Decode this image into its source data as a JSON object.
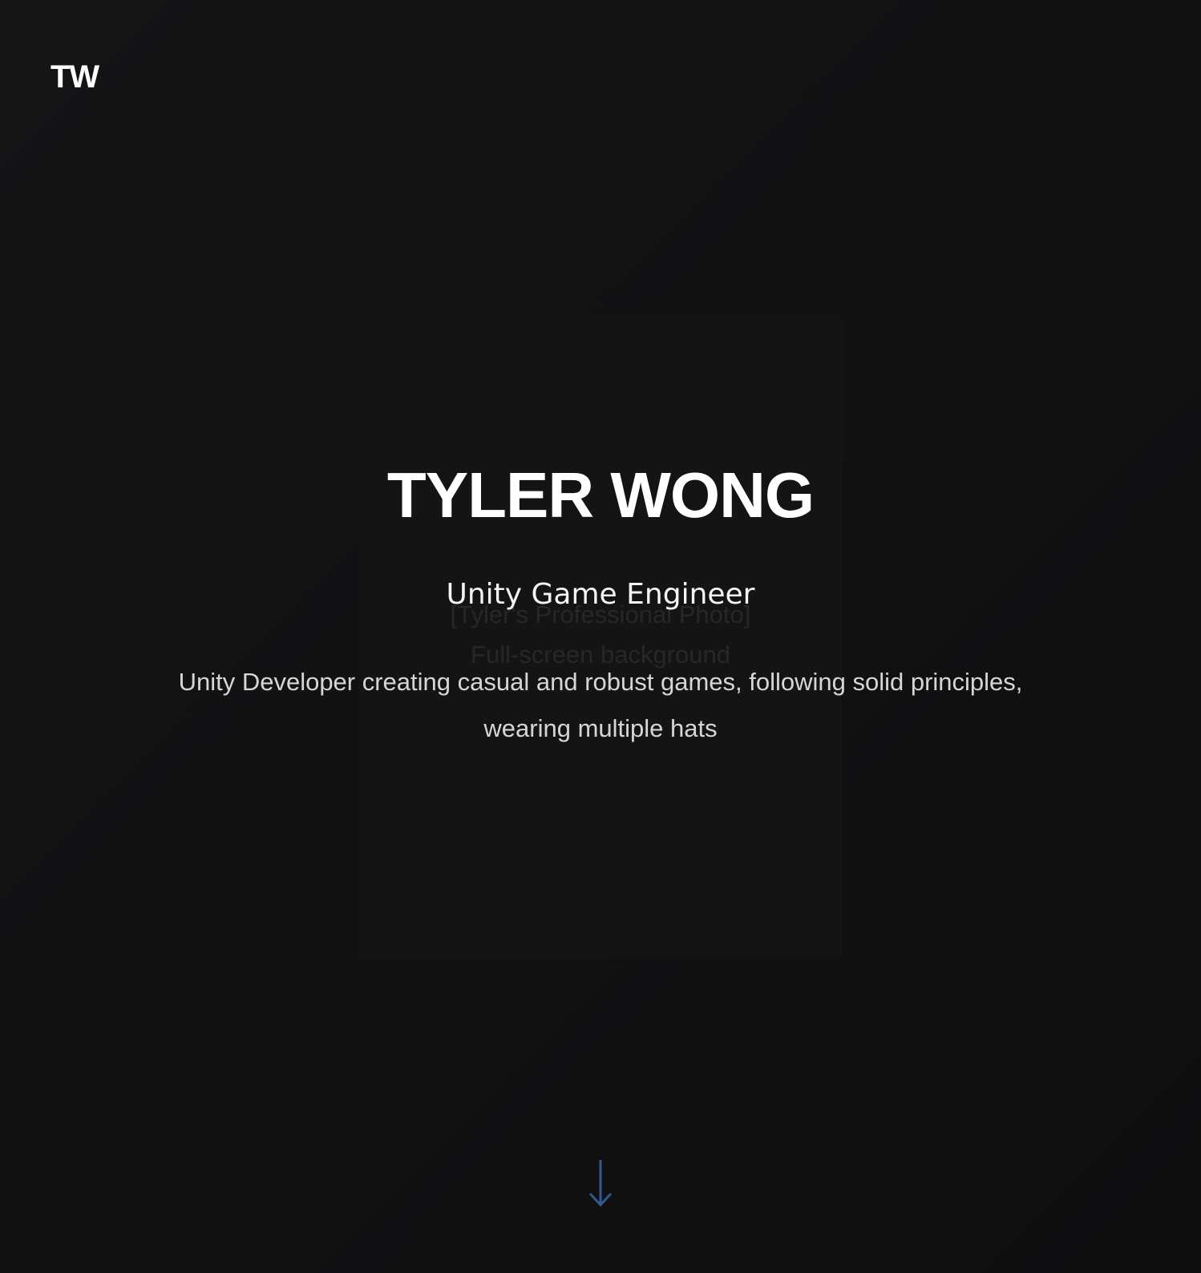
{
  "header": {
    "logo_text": "TW"
  },
  "hero": {
    "photo_placeholder": {
      "line1": "[Tyler's Professional Photo]",
      "line2": "Full-screen background"
    },
    "name": "TYLER WONG",
    "role": "Unity Game Engineer",
    "tagline": "Unity Developer creating casual and robust games, following solid principles, wearing multiple hats"
  },
  "scroll_indicator": {
    "icon": "arrow-down-icon",
    "color": "#2f5a8f"
  },
  "colors": {
    "background": "#111112",
    "text_primary": "#ffffff",
    "text_secondary": "#d6d6d6",
    "accent": "#2f5a8f"
  }
}
